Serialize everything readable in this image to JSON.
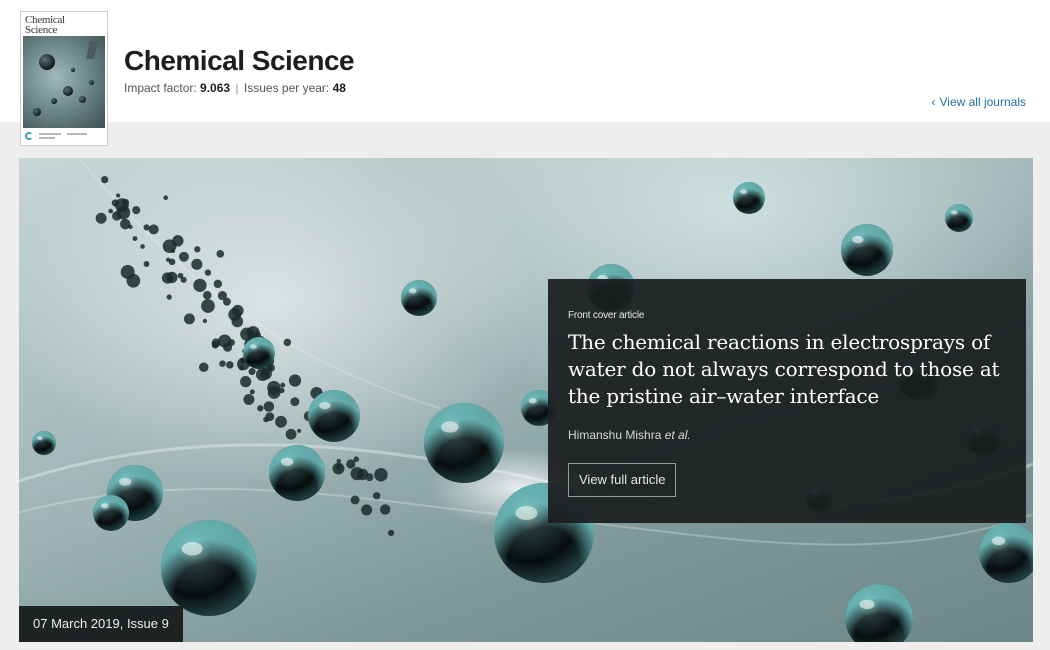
{
  "journal": {
    "thumbnail_title": "Chemical Science",
    "title": "Chemical Science",
    "impact_label": "Impact factor:",
    "impact_value": "9.063",
    "separator": "|",
    "issues_label": "Issues per year:",
    "issues_value": "48"
  },
  "nav": {
    "view_all_icon": "chevron-left-icon",
    "view_all_label": "View all journals"
  },
  "featured": {
    "kicker": "Front cover article",
    "title": "The chemical reactions in electrosprays of water do not always correspond to those at the pristine air–water interface",
    "authors": "Himanshu Mishra",
    "authors_suffix": "et al.",
    "button_label": "View full article",
    "issue": "07 March 2019, Issue 9"
  },
  "colors": {
    "link": "#1e6fa8",
    "panel": "#1b1d1e",
    "band": "#eeeeee",
    "sphere_highlight": "#7fd9d9"
  }
}
